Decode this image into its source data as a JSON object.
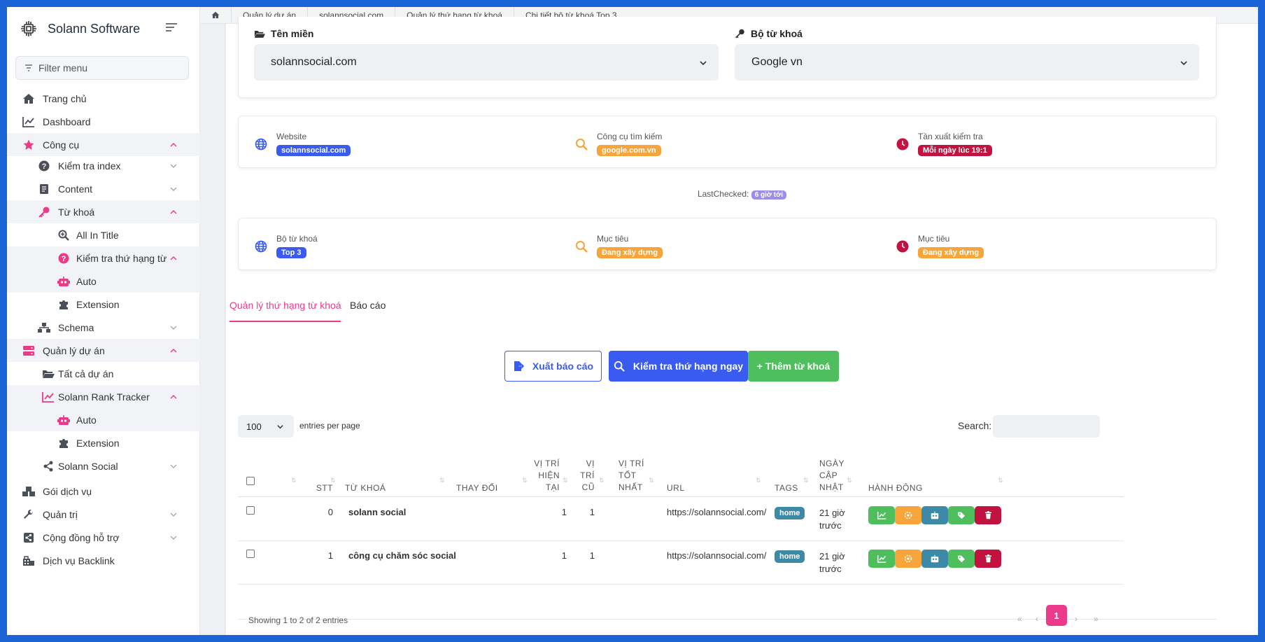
{
  "sidebar": {
    "brand": "Solann Software",
    "filter_placeholder": "Filter menu",
    "items": [
      {
        "label": "Trang chủ"
      },
      {
        "label": "Dashboard"
      },
      {
        "label": "Công cụ"
      },
      {
        "label": "Kiểm tra index"
      },
      {
        "label": "Content"
      },
      {
        "label": "Từ khoá"
      },
      {
        "label": "All In Title"
      },
      {
        "label": "Kiểm tra thứ hạng từ k..."
      },
      {
        "label": "Auto"
      },
      {
        "label": "Extension"
      },
      {
        "label": "Schema"
      },
      {
        "label": "Quản lý dự án"
      },
      {
        "label": "Tất cả dự án"
      },
      {
        "label": "Solann Rank Tracker"
      },
      {
        "label": "Auto"
      },
      {
        "label": "Extension"
      },
      {
        "label": "Solann Social"
      },
      {
        "label": "Gói dịch vụ"
      },
      {
        "label": "Quản trị"
      },
      {
        "label": "Cộng đồng hỗ trợ"
      },
      {
        "label": "Dịch vụ Backlink"
      }
    ]
  },
  "breadcrumb": [
    "Quản lý dự án",
    "solannsocial.com",
    "Quản lý thứ hạng từ khoá",
    "Chi tiết bộ từ khoá Top 3"
  ],
  "filters": {
    "domain_label": "Tên miền",
    "domain_value": "solannsocial.com",
    "keyword_set_label": "Bộ từ khoá",
    "keyword_set_value": "Google vn"
  },
  "info1": {
    "website_label": "Website",
    "website_value": "solannsocial.com",
    "engine_label": "Công cụ tìm kiếm",
    "engine_value": "google.com.vn",
    "freq_label": "Tần xuất kiểm tra",
    "freq_value": "Mỗi ngày lúc 19:1"
  },
  "last_checked": {
    "label": "LastChecked:",
    "value": "6 giờ tới"
  },
  "info2": {
    "set_label": "Bộ từ khoá",
    "set_value": "Top 3",
    "goal_label": "Mục tiêu",
    "goal_value": "Đang xây dựng",
    "goal2_label": "Mục tiêu",
    "goal2_value": "Đang xây dựng"
  },
  "tabs": [
    "Quản lý thứ hạng từ khoá",
    "Báo cáo"
  ],
  "buttons": {
    "export": "Xuất báo cáo",
    "check": "Kiểm tra thứ hạng ngay",
    "add": "+ Thêm từ khoá"
  },
  "table": {
    "page_size": "100",
    "entries_label": "entries per page",
    "search_label": "Search:",
    "headers": {
      "stt": "STT",
      "keyword": "TỪ KHOÁ",
      "change": "THAY ĐỔI",
      "current": [
        "VỊ TRÍ",
        "HIỆN",
        "TẠI"
      ],
      "old": [
        "VỊ",
        "TRÍ",
        "CŨ"
      ],
      "best": [
        "VỊ TRÍ",
        "TỐT",
        "NHẤT"
      ],
      "url": "URL",
      "tags": "TAGS",
      "updated": [
        "NGÀY",
        "CẬP",
        "NHẬT"
      ],
      "actions": "HÀNH ĐỘNG"
    },
    "rows": [
      {
        "stt": "0",
        "keyword": "solann social",
        "change": "",
        "current": "1",
        "old": "1",
        "best": "",
        "url": "https://solannsocial.com/",
        "tag": "home",
        "updated": [
          "21 giờ",
          "trước"
        ]
      },
      {
        "stt": "1",
        "keyword": "công cụ chăm sóc social",
        "change": "",
        "current": "1",
        "old": "1",
        "best": "",
        "url": "https://solannsocial.com/",
        "tag": "home",
        "updated": [
          "21 giờ",
          "trước"
        ]
      }
    ],
    "footer": "Showing 1 to 2 of 2 entries",
    "pagination": {
      "first": "«",
      "prev": "‹",
      "current": "1",
      "next": "›",
      "last": "»"
    }
  },
  "colors": {
    "primary": "#3a5bef",
    "pink": "#ec3a8a",
    "orange": "#f7a43a",
    "crimson": "#c2123f",
    "green": "#4fbf5e",
    "lavender": "#9b8fe8",
    "teal": "#3d8aa6"
  }
}
